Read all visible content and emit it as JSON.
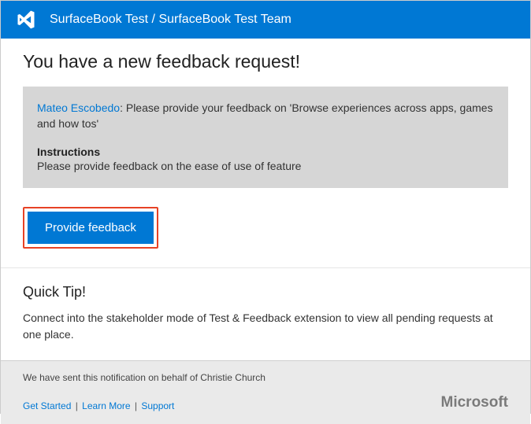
{
  "header": {
    "title": "SurfaceBook Test / SurfaceBook Test Team"
  },
  "main": {
    "title": "You have a new feedback request!",
    "requester": "Mateo Escobedo",
    "message_after_name": ": Please provide your feedback on 'Browse experiences across  apps, games and how tos'",
    "instructions_label": "Instructions",
    "instructions_text": "Please provide feedback on the ease of use of feature",
    "cta_label": "Provide feedback"
  },
  "tip": {
    "title": "Quick Tip!",
    "text": "Connect into the stakeholder mode of Test & Feedback extension to view all pending requests at one place."
  },
  "footer": {
    "notice_prefix": "We have sent this notification on behalf of  ",
    "sender": "Christie Church",
    "links": {
      "get_started": "Get Started",
      "learn_more": "Learn More",
      "support": "Support"
    },
    "brand": "Microsoft"
  }
}
